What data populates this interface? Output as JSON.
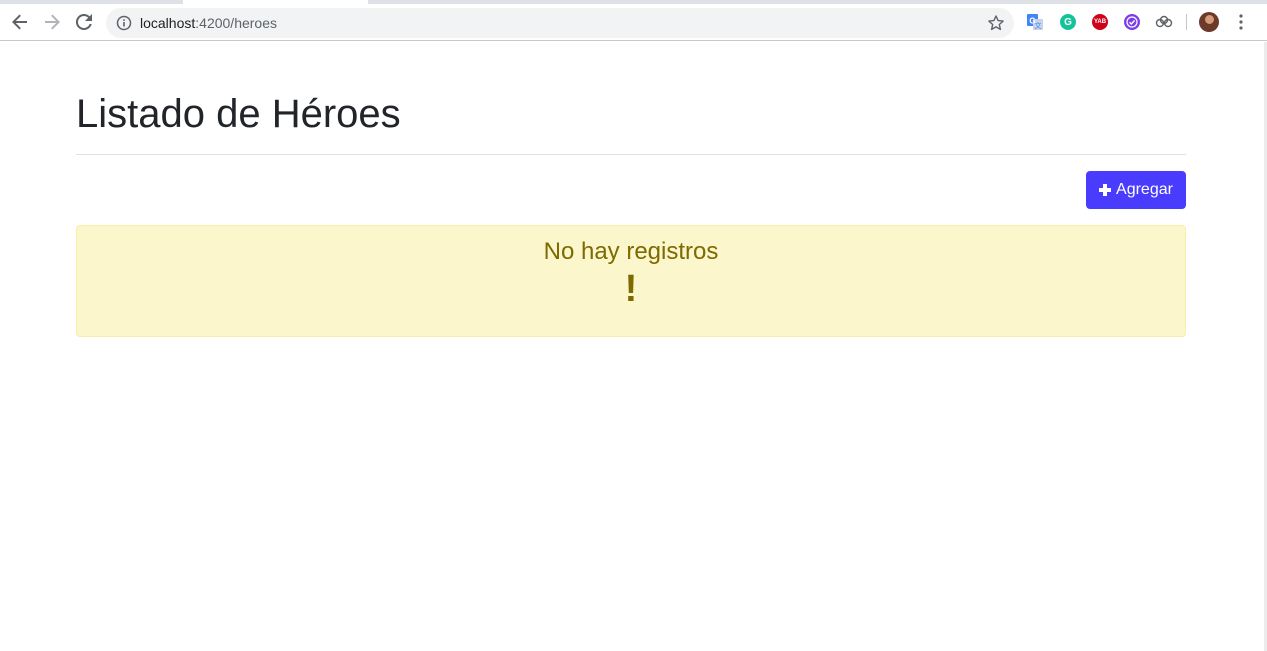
{
  "browser": {
    "url_host": "localhost",
    "url_path": ":4200/heroes",
    "icons": {
      "back": "arrow-left-icon",
      "forward": "arrow-right-icon",
      "reload": "reload-icon",
      "info": "info-icon",
      "bookmark": "star-icon",
      "menu": "kebab-menu-icon"
    },
    "extensions": [
      {
        "name": "google-translate-icon",
        "color": "#4285f4"
      },
      {
        "name": "grammarly-icon",
        "color": "#15c39a",
        "glyph": "G"
      },
      {
        "name": "yab-icon",
        "color": "#d0021b",
        "glyph": "YAB"
      },
      {
        "name": "checkmark-extension-icon",
        "color": "#7b3fe4"
      },
      {
        "name": "cloud-sync-icon",
        "color": "#5f6368"
      }
    ]
  },
  "page": {
    "title": "Listado de Héroes",
    "add_button_label": "Agregar",
    "alert": {
      "heading": "No hay registros",
      "icon_glyph": "!",
      "background": "#fbf6cc",
      "text_color": "#7d6a00"
    },
    "accent_color": "#4a3cff"
  }
}
